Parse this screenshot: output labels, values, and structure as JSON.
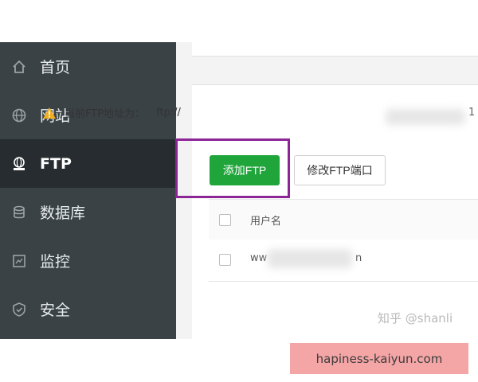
{
  "sidebar": {
    "items": [
      {
        "label": "首页",
        "icon": "home-icon"
      },
      {
        "label": "网站",
        "icon": "globe-icon"
      },
      {
        "label": "FTP",
        "icon": "ftp-icon",
        "active": true
      },
      {
        "label": "数据库",
        "icon": "database-icon"
      },
      {
        "label": "监控",
        "icon": "monitor-icon"
      },
      {
        "label": "安全",
        "icon": "shield-icon"
      }
    ]
  },
  "notice": {
    "label": "当前FTP地址为：",
    "value": "ftp://",
    "value_tail": "1"
  },
  "toolbar": {
    "add_label": "添加FTP",
    "modify_port_label": "修改FTP端口"
  },
  "table": {
    "column_username": "用户名",
    "rows": [
      {
        "user_start": "ww",
        "user_end": "n"
      }
    ]
  },
  "watermark": "知乎 @shanli",
  "site_label": "hapiness-kaiyun.com",
  "colors": {
    "sidebar_bg": "#3a4246",
    "sidebar_active": "#262c30",
    "add_button": "#20a53a",
    "highlight_border": "#8e2597",
    "site_label_bg": "#f4a5a6"
  }
}
